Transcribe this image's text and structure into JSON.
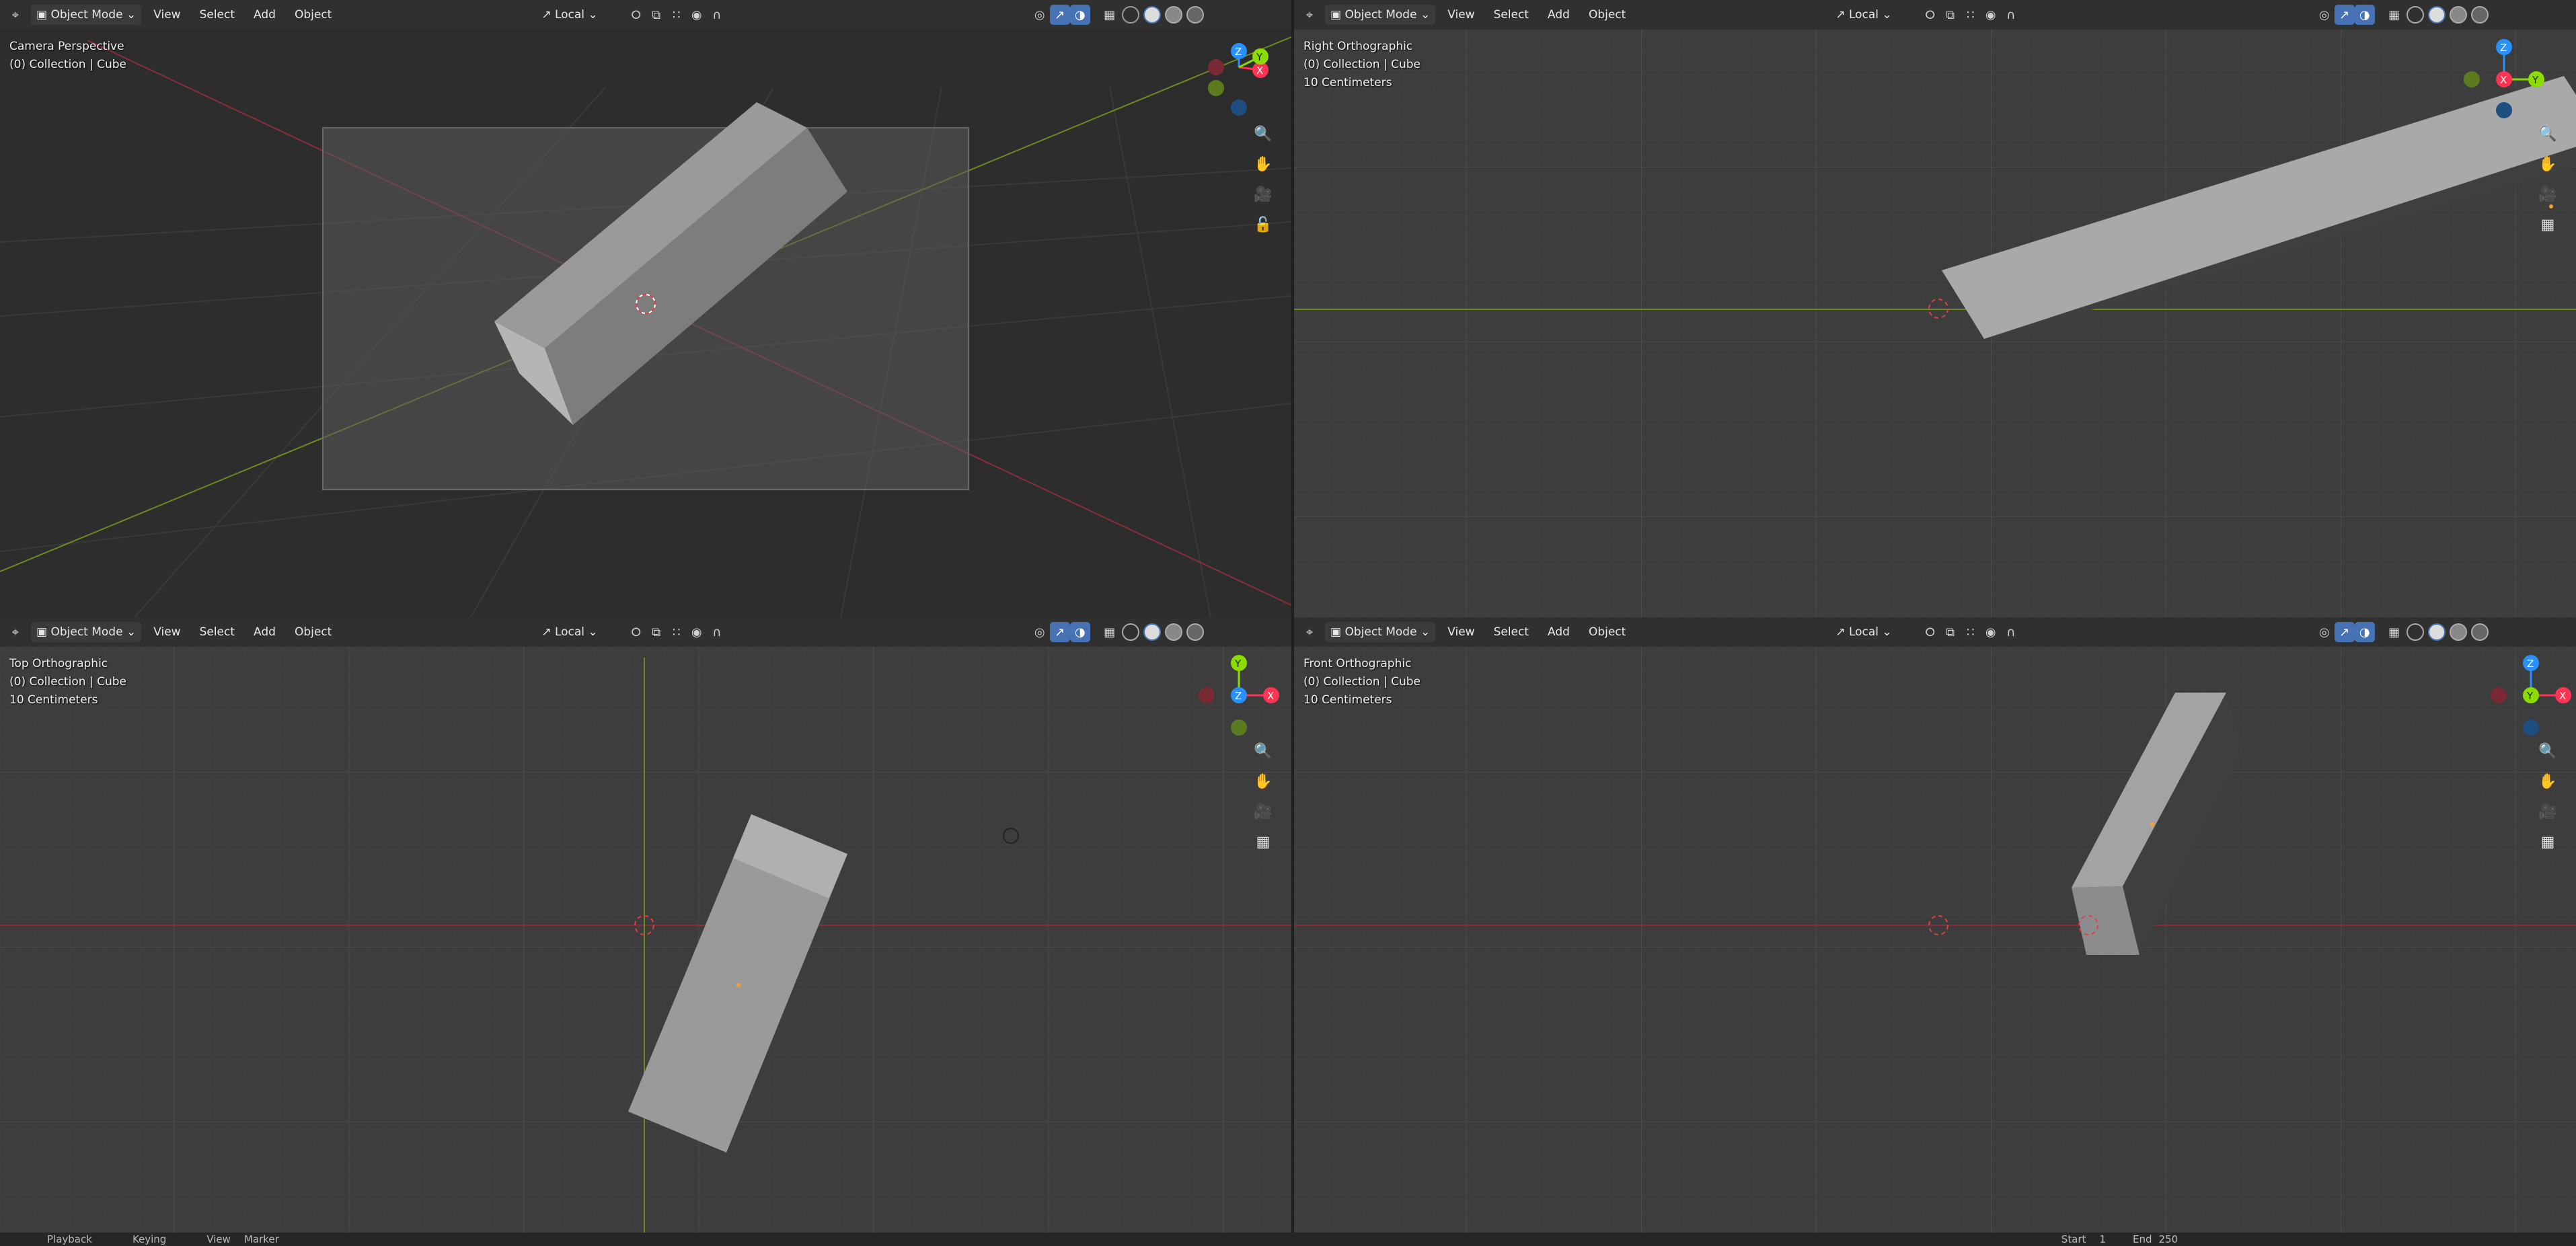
{
  "viewports": [
    {
      "id": "top-left",
      "header": {
        "mode": "Object Mode",
        "menus": [
          "View",
          "Select",
          "Add",
          "Object"
        ],
        "orientation": "Local"
      },
      "info": {
        "view_name": "Camera Perspective",
        "collection": "(0) Collection | Cube",
        "scale": ""
      },
      "gizmo_axes": [
        "Z",
        "Y",
        "X"
      ]
    },
    {
      "id": "top-right",
      "header": {
        "mode": "Object Mode",
        "menus": [
          "View",
          "Select",
          "Add",
          "Object"
        ],
        "orientation": "Local"
      },
      "info": {
        "view_name": "Right Orthographic",
        "collection": "(0) Collection | Cube",
        "scale": "10 Centimeters"
      },
      "gizmo_axes": [
        "Z",
        "X",
        "Y"
      ]
    },
    {
      "id": "bottom-left",
      "header": {
        "mode": "Object Mode",
        "menus": [
          "View",
          "Select",
          "Add",
          "Object"
        ],
        "orientation": "Local"
      },
      "info": {
        "view_name": "Top Orthographic",
        "collection": "(0) Collection | Cube",
        "scale": "10 Centimeters"
      },
      "gizmo_axes": [
        "Y",
        "Z",
        "X"
      ]
    },
    {
      "id": "bottom-right",
      "header": {
        "mode": "Object Mode",
        "menus": [
          "View",
          "Select",
          "Add",
          "Object"
        ],
        "orientation": "Local"
      },
      "info": {
        "view_name": "Front Orthographic",
        "collection": "(0) Collection | Cube",
        "scale": "10 Centimeters"
      },
      "gizmo_axes": [
        "Z",
        "Y",
        "X"
      ]
    }
  ],
  "timeline": {
    "items": [
      "Playback",
      "Keying",
      "View",
      "Marker"
    ],
    "start_label": "Start",
    "start_value": "1",
    "end_label": "End",
    "end_value": "250"
  },
  "colors": {
    "x_axis": "#ff3352",
    "y_axis": "#8bdc00",
    "z_axis": "#2890ff",
    "active_blue": "#4772b3",
    "header_bg": "#303030",
    "viewport_bg": "#3d3d3d"
  }
}
